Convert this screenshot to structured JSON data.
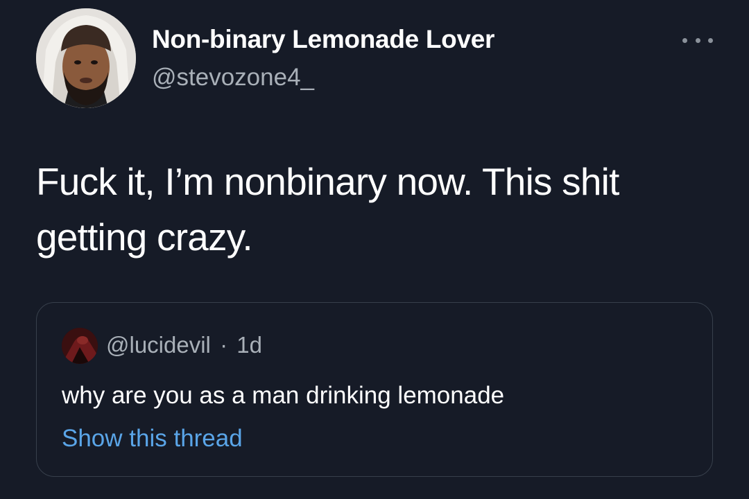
{
  "tweet": {
    "author": {
      "display_name": "Non-binary Lemonade Lover",
      "handle": "@stevozone4_",
      "avatar_icon": "user-avatar"
    },
    "text": "Fuck it, I’m nonbinary now. This shit getting crazy.",
    "more_icon": "more-horizontal-icon"
  },
  "quoted_tweet": {
    "handle": "@lucidevil",
    "separator": "·",
    "age": "1d",
    "avatar_icon": "user-avatar",
    "text": "why are you as a man drinking lemonade",
    "show_thread_label": "Show this thread"
  },
  "colors": {
    "background": "#161b27",
    "primary_text": "#ffffff",
    "secondary_text": "#a9b0b8",
    "link": "#5aa5e8",
    "card_border": "#38404c"
  }
}
